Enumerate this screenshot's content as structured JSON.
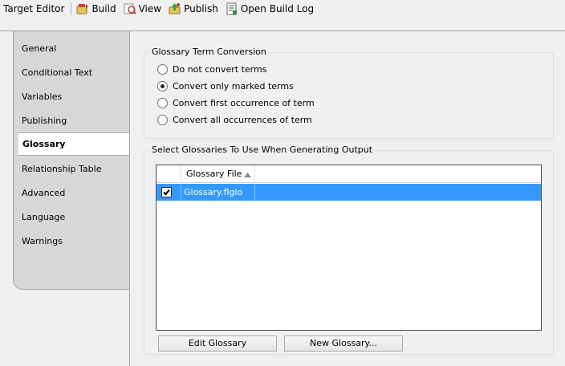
{
  "toolbar": {
    "title": "Target Editor",
    "build_label": "Build",
    "view_label": "View",
    "publish_label": "Publish",
    "open_build_log_label": "Open Build Log"
  },
  "tabs": [
    {
      "label": "General"
    },
    {
      "label": "Conditional Text"
    },
    {
      "label": "Variables"
    },
    {
      "label": "Publishing"
    },
    {
      "label": "Glossary",
      "active": true
    },
    {
      "label": "Relationship Table"
    },
    {
      "label": "Advanced"
    },
    {
      "label": "Language"
    },
    {
      "label": "Warnings"
    }
  ],
  "conversion": {
    "title": "Glossary Term Conversion",
    "options": [
      {
        "label": "Do not convert terms",
        "checked": false
      },
      {
        "label": "Convert only marked terms",
        "checked": true
      },
      {
        "label": "Convert first occurrence of term",
        "checked": false
      },
      {
        "label": "Convert all occurrences of term",
        "checked": false
      }
    ]
  },
  "glossaries": {
    "title": "Select Glossaries To Use When Generating Output",
    "column_header": "Glossary File",
    "rows": [
      {
        "file": "Glossary.flglo",
        "checked": true
      }
    ],
    "edit_button": "Edit Glossary",
    "new_button": "New Glossary..."
  }
}
